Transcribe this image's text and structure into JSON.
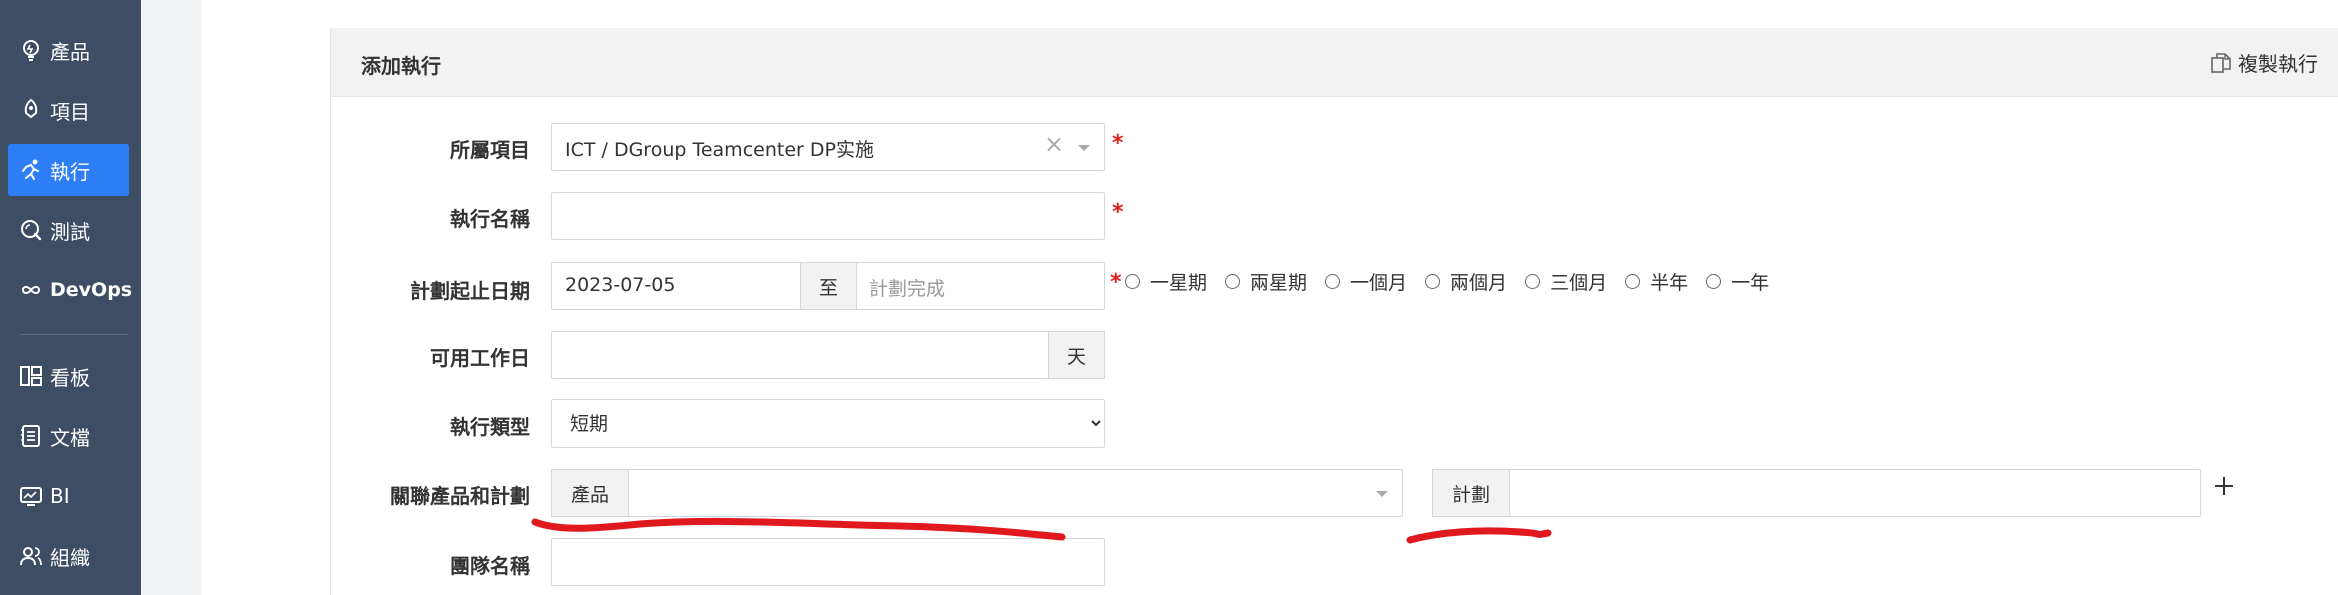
{
  "sidebar": {
    "items": [
      {
        "label": "產品",
        "icon": "bulb-icon"
      },
      {
        "label": "項目",
        "icon": "project-icon"
      },
      {
        "label": "執行",
        "icon": "run-icon",
        "active": true
      },
      {
        "label": "測試",
        "icon": "test-icon"
      },
      {
        "label": "DevOps",
        "icon": "infinity-icon"
      },
      {
        "label": "看板",
        "icon": "board-icon"
      },
      {
        "label": "文檔",
        "icon": "doc-icon"
      },
      {
        "label": "BI",
        "icon": "monitor-icon"
      },
      {
        "label": "組織",
        "icon": "users-icon"
      }
    ],
    "bg_color": "#3d4d63",
    "active_color": "#2e7ff7"
  },
  "panel": {
    "title": "添加執行",
    "copy_label": "複製執行"
  },
  "form": {
    "project": {
      "label": "所屬項目",
      "value": "ICT / DGroup Teamcenter DP实施"
    },
    "name": {
      "label": "執行名稱",
      "value": ""
    },
    "dates": {
      "label": "計劃起止日期",
      "start": "2023-07-05",
      "separator": "至",
      "end_placeholder": "計劃完成",
      "quick_options": [
        "一星期",
        "兩星期",
        "一個月",
        "兩個月",
        "三個月",
        "半年",
        "一年"
      ]
    },
    "workdays": {
      "label": "可用工作日",
      "value": "",
      "unit": "天"
    },
    "type": {
      "label": "執行類型",
      "selected": "短期"
    },
    "linked": {
      "label": "關聯產品和計劃",
      "product_addon": "產品",
      "plan_addon": "計劃"
    },
    "team": {
      "label": "團隊名稱",
      "value": ""
    }
  },
  "required_mark": "*",
  "annotation_color": "#e0191f"
}
